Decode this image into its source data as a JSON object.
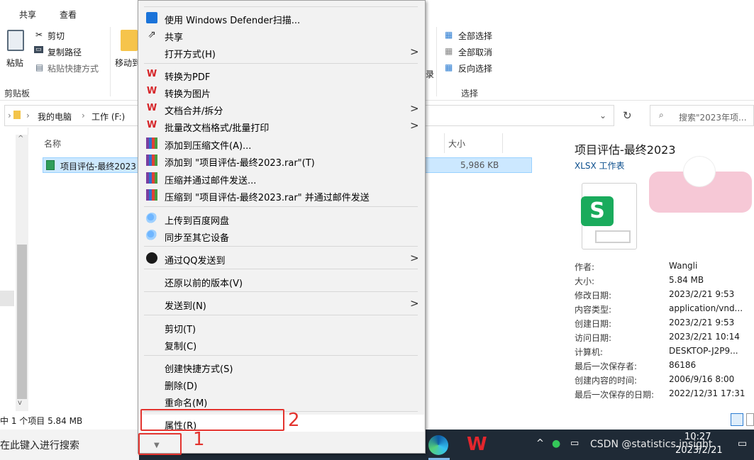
{
  "ribbon": {
    "tabs": [
      "共享",
      "查看"
    ],
    "clipboard": {
      "paste": "粘贴",
      "cut": "剪切",
      "copy_path": "复制路径",
      "paste_shortcut": "粘贴快捷方式",
      "group_label": "剪贴板"
    },
    "move_to_partial": "移动到",
    "partial_record": "录",
    "select": {
      "select_all": "全部选择",
      "select_none": "全部取消",
      "invert": "反向选择",
      "group_label": "选择"
    }
  },
  "address": {
    "crumbs": [
      "我的电脑",
      "工作 (F:)"
    ],
    "search_placeholder": "搜索\"2023年项..."
  },
  "filelist": {
    "col_name": "名称",
    "col_size": "大小",
    "file_name": "项目评估-最终2023",
    "file_size": "5,986 KB"
  },
  "details": {
    "title": "项目评估-最终2023",
    "type": "XLSX 工作表",
    "rows": [
      {
        "k": "作者:",
        "v": "Wangli"
      },
      {
        "k": "大小:",
        "v": "5.84 MB"
      },
      {
        "k": "修改日期:",
        "v": "2023/2/21 9:53"
      },
      {
        "k": "内容类型:",
        "v": "application/vnd..."
      },
      {
        "k": "创建日期:",
        "v": "2023/2/21 9:53"
      },
      {
        "k": "访问日期:",
        "v": "2023/2/21 10:14"
      },
      {
        "k": "计算机:",
        "v": "DESKTOP-J2P9..."
      },
      {
        "k": "最后一次保存者:",
        "v": "86186"
      },
      {
        "k": "创建内容的时间:",
        "v": "2006/9/16 8:00"
      },
      {
        "k": "最后一次保存的日期:",
        "v": "2022/12/31 17:31"
      }
    ]
  },
  "status": {
    "text": "中 1 个项目  5.84 MB"
  },
  "taskbar": {
    "search_text": "在此键入进行搜索",
    "time": "10:27",
    "date": "2023/2/21",
    "watermark": "CSDN @statistics.insight"
  },
  "menu": {
    "items": [
      "使用 Windows Defender扫描...",
      "共享",
      "打开方式(H)",
      "转换为PDF",
      "转换为图片",
      "文档合并/拆分",
      "批量改文档格式/批量打印",
      "添加到压缩文件(A)...",
      "添加到 \"项目评估-最终2023.rar\"(T)",
      "压缩并通过邮件发送...",
      "压缩到 \"项目评估-最终2023.rar\" 并通过邮件发送",
      "上传到百度网盘",
      "同步至其它设备",
      "通过QQ发送到",
      "还原以前的版本(V)",
      "发送到(N)",
      "剪切(T)",
      "复制(C)",
      "创建快捷方式(S)",
      "删除(D)",
      "重命名(M)",
      "属性(R)"
    ],
    "more_arrow": "▼"
  },
  "annotations": {
    "one": "1",
    "two": "2"
  },
  "colors": {
    "accent": "#0078d7",
    "annotation": "#e3342f",
    "wps_red": "#d6262a",
    "selection": "#cce8ff"
  }
}
